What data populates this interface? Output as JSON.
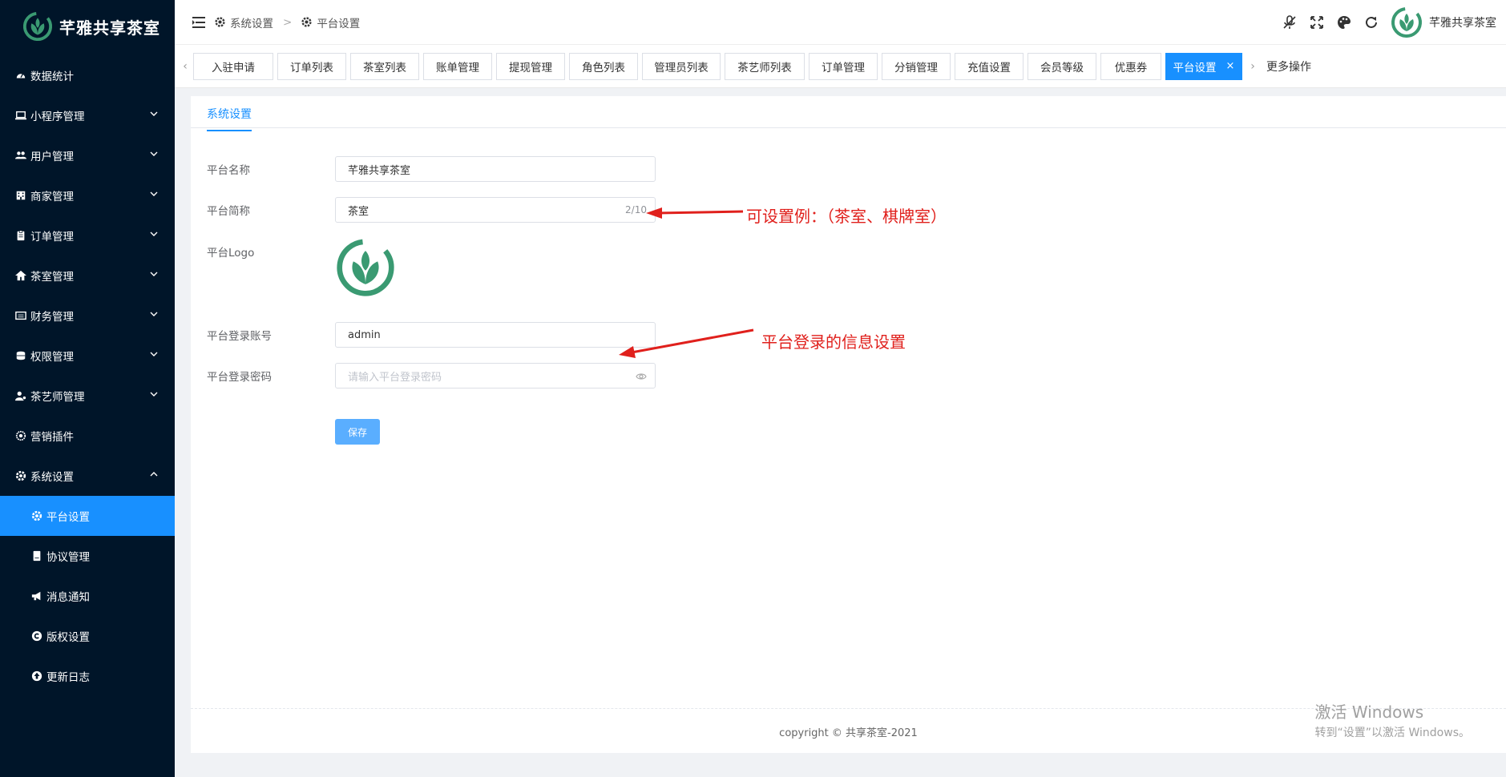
{
  "brand": {
    "name": "芊雅共享茶室",
    "accent": "#1890ff",
    "sidebar_bg": "#001529",
    "logo_color": "#3a9a72"
  },
  "sidebar": {
    "items": [
      {
        "label": "数据统计",
        "icon": "dashboard-icon"
      },
      {
        "label": "小程序管理",
        "icon": "laptop-icon"
      },
      {
        "label": "用户管理",
        "icon": "users-icon"
      },
      {
        "label": "商家管理",
        "icon": "building-icon"
      },
      {
        "label": "订单管理",
        "icon": "clipboard-icon"
      },
      {
        "label": "茶室管理",
        "icon": "home-icon"
      },
      {
        "label": "财务管理",
        "icon": "money-icon"
      },
      {
        "label": "权限管理",
        "icon": "coins-icon"
      },
      {
        "label": "茶艺师管理",
        "icon": "user-gear-icon"
      },
      {
        "label": "营销插件",
        "icon": "settings-icon"
      },
      {
        "label": "系统设置",
        "icon": "gear-icon"
      }
    ],
    "subitems": [
      {
        "label": "平台设置",
        "icon": "gear-icon"
      },
      {
        "label": "协议管理",
        "icon": "book-icon"
      },
      {
        "label": "消息通知",
        "icon": "megaphone-icon"
      },
      {
        "label": "版权设置",
        "icon": "copyright-icon"
      },
      {
        "label": "更新日志",
        "icon": "arrow-up-circle-icon"
      }
    ]
  },
  "header": {
    "breadcrumb": [
      "系统设置",
      "平台设置"
    ],
    "breadcrumb_sep": ">",
    "user_name": "芊雅共享茶室"
  },
  "tabs": {
    "items": [
      "入驻申请",
      "订单列表",
      "茶室列表",
      "账单管理",
      "提现管理",
      "角色列表",
      "管理员列表",
      "茶艺师列表",
      "订单管理",
      "分销管理",
      "充值设置",
      "会员等级",
      "优惠券",
      "平台设置"
    ],
    "active_close": "×",
    "more": "更多操作"
  },
  "page": {
    "tab": "系统设置",
    "fields": {
      "name_label": "平台名称",
      "name_value": "芊雅共享茶室",
      "short_label": "平台简称",
      "short_value": "茶室",
      "short_count": "2/10",
      "logo_label": "平台Logo",
      "account_label": "平台登录账号",
      "account_value": "admin",
      "password_label": "平台登录密码",
      "password_placeholder": "请输入平台登录密码"
    },
    "save": "保存",
    "footer": "copyright © 共享茶室-2021"
  },
  "annotations": {
    "short_note": "可设置例：（茶室、棋牌室）",
    "login_note": "平台登录的信息设置"
  },
  "watermark": {
    "title": "激活 Windows",
    "sub": "转到“设置”以激活 Windows。"
  }
}
